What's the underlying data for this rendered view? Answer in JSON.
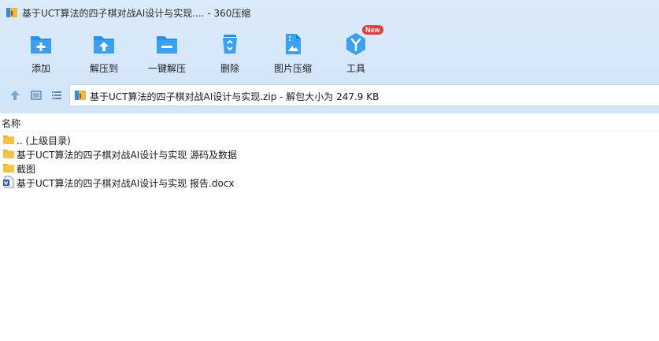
{
  "window": {
    "title": "基于UCT算法的四子棋对战AI设计与实现.... - 360压缩"
  },
  "toolbar": {
    "items": [
      {
        "label": "添加",
        "icon": "add-icon"
      },
      {
        "label": "解压到",
        "icon": "extract-to-icon"
      },
      {
        "label": "一键解压",
        "icon": "one-click-extract-icon"
      },
      {
        "label": "删除",
        "icon": "recycle-icon"
      },
      {
        "label": "图片压缩",
        "icon": "image-compress-icon"
      },
      {
        "label": "工具",
        "icon": "tools-icon",
        "badge": "New"
      }
    ]
  },
  "path": {
    "text": "基于UCT算法的四子棋对战AI设计与实现.zip - 解包大小为 247.9 KB"
  },
  "list": {
    "column_name": "名称",
    "rows": [
      {
        "name": ".. (上级目录)",
        "icon": "folder-icon"
      },
      {
        "name": "基于UCT算法的四子棋对战AI设计与实现 源码及数据",
        "icon": "folder-icon"
      },
      {
        "name": "截图",
        "icon": "folder-icon"
      },
      {
        "name": "基于UCT算法的四子棋对战AI设计与实现 报告.docx",
        "icon": "word-doc-icon"
      }
    ]
  },
  "colors": {
    "accent": "#2a8fe6",
    "toolbar_bg": "#d5e7fa",
    "badge": "#e23b3b",
    "folder": "#f5c242"
  }
}
